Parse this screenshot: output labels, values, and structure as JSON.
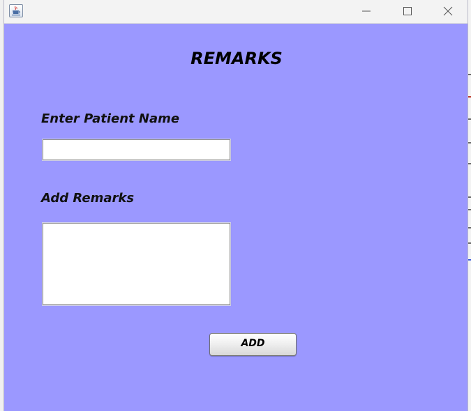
{
  "window": {
    "icon": "java-cup-icon",
    "controls": {
      "minimize": "minimize-icon",
      "maximize": "maximize-icon",
      "close": "close-icon"
    }
  },
  "form": {
    "heading": "REMARKS",
    "patient_name_label": "Enter Patient Name",
    "patient_name_value": "",
    "remarks_label": "Add Remarks",
    "remarks_value": "",
    "add_button_label": "ADD"
  },
  "colors": {
    "panel_background": "#9b98ff",
    "titlebar_background": "#f3f3f3"
  }
}
